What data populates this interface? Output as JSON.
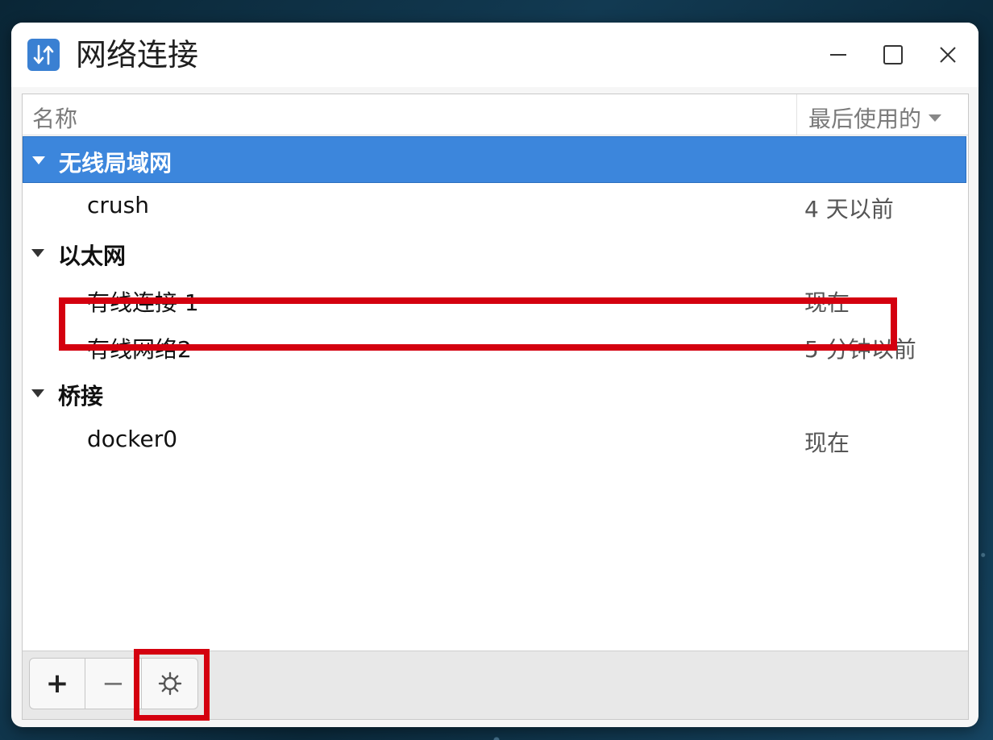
{
  "window": {
    "title": "网络连接",
    "icon": "network-arrows-icon",
    "controls": [
      "minimize-icon",
      "maximize-icon",
      "close-icon"
    ]
  },
  "list": {
    "columns": {
      "name": "名称",
      "last_used": "最后使用的"
    },
    "groups": [
      {
        "label": "无线局域网",
        "selected": true,
        "items": [
          {
            "name": "crush",
            "last_used": "4 天以前"
          }
        ]
      },
      {
        "label": "以太网",
        "selected": false,
        "items": [
          {
            "name": "有线连接 1",
            "last_used": "现在",
            "highlighted": true
          },
          {
            "name": "有线网络2",
            "last_used": "5 分钟以前"
          }
        ]
      },
      {
        "label": "桥接",
        "selected": false,
        "items": [
          {
            "name": "docker0",
            "last_used": "现在"
          }
        ]
      }
    ]
  },
  "toolbar": {
    "add_label": "+",
    "remove_label": "−",
    "settings_icon": "gear-icon",
    "settings_highlighted": true
  },
  "colors": {
    "selection": "#3c86dc",
    "highlight_annotation": "#d4000f",
    "app_icon": "#3a80d2"
  }
}
